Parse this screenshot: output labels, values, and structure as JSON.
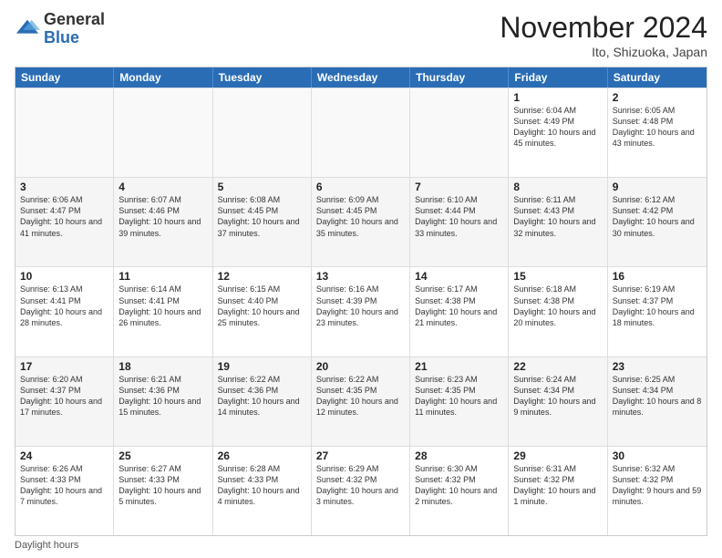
{
  "logo": {
    "general": "General",
    "blue": "Blue"
  },
  "title": "November 2024",
  "location": "Ito, Shizuoka, Japan",
  "weekdays": [
    "Sunday",
    "Monday",
    "Tuesday",
    "Wednesday",
    "Thursday",
    "Friday",
    "Saturday"
  ],
  "footer": "Daylight hours",
  "weeks": [
    [
      {
        "day": "",
        "info": ""
      },
      {
        "day": "",
        "info": ""
      },
      {
        "day": "",
        "info": ""
      },
      {
        "day": "",
        "info": ""
      },
      {
        "day": "",
        "info": ""
      },
      {
        "day": "1",
        "info": "Sunrise: 6:04 AM\nSunset: 4:49 PM\nDaylight: 10 hours and 45 minutes."
      },
      {
        "day": "2",
        "info": "Sunrise: 6:05 AM\nSunset: 4:48 PM\nDaylight: 10 hours and 43 minutes."
      }
    ],
    [
      {
        "day": "3",
        "info": "Sunrise: 6:06 AM\nSunset: 4:47 PM\nDaylight: 10 hours and 41 minutes."
      },
      {
        "day": "4",
        "info": "Sunrise: 6:07 AM\nSunset: 4:46 PM\nDaylight: 10 hours and 39 minutes."
      },
      {
        "day": "5",
        "info": "Sunrise: 6:08 AM\nSunset: 4:45 PM\nDaylight: 10 hours and 37 minutes."
      },
      {
        "day": "6",
        "info": "Sunrise: 6:09 AM\nSunset: 4:45 PM\nDaylight: 10 hours and 35 minutes."
      },
      {
        "day": "7",
        "info": "Sunrise: 6:10 AM\nSunset: 4:44 PM\nDaylight: 10 hours and 33 minutes."
      },
      {
        "day": "8",
        "info": "Sunrise: 6:11 AM\nSunset: 4:43 PM\nDaylight: 10 hours and 32 minutes."
      },
      {
        "day": "9",
        "info": "Sunrise: 6:12 AM\nSunset: 4:42 PM\nDaylight: 10 hours and 30 minutes."
      }
    ],
    [
      {
        "day": "10",
        "info": "Sunrise: 6:13 AM\nSunset: 4:41 PM\nDaylight: 10 hours and 28 minutes."
      },
      {
        "day": "11",
        "info": "Sunrise: 6:14 AM\nSunset: 4:41 PM\nDaylight: 10 hours and 26 minutes."
      },
      {
        "day": "12",
        "info": "Sunrise: 6:15 AM\nSunset: 4:40 PM\nDaylight: 10 hours and 25 minutes."
      },
      {
        "day": "13",
        "info": "Sunrise: 6:16 AM\nSunset: 4:39 PM\nDaylight: 10 hours and 23 minutes."
      },
      {
        "day": "14",
        "info": "Sunrise: 6:17 AM\nSunset: 4:38 PM\nDaylight: 10 hours and 21 minutes."
      },
      {
        "day": "15",
        "info": "Sunrise: 6:18 AM\nSunset: 4:38 PM\nDaylight: 10 hours and 20 minutes."
      },
      {
        "day": "16",
        "info": "Sunrise: 6:19 AM\nSunset: 4:37 PM\nDaylight: 10 hours and 18 minutes."
      }
    ],
    [
      {
        "day": "17",
        "info": "Sunrise: 6:20 AM\nSunset: 4:37 PM\nDaylight: 10 hours and 17 minutes."
      },
      {
        "day": "18",
        "info": "Sunrise: 6:21 AM\nSunset: 4:36 PM\nDaylight: 10 hours and 15 minutes."
      },
      {
        "day": "19",
        "info": "Sunrise: 6:22 AM\nSunset: 4:36 PM\nDaylight: 10 hours and 14 minutes."
      },
      {
        "day": "20",
        "info": "Sunrise: 6:22 AM\nSunset: 4:35 PM\nDaylight: 10 hours and 12 minutes."
      },
      {
        "day": "21",
        "info": "Sunrise: 6:23 AM\nSunset: 4:35 PM\nDaylight: 10 hours and 11 minutes."
      },
      {
        "day": "22",
        "info": "Sunrise: 6:24 AM\nSunset: 4:34 PM\nDaylight: 10 hours and 9 minutes."
      },
      {
        "day": "23",
        "info": "Sunrise: 6:25 AM\nSunset: 4:34 PM\nDaylight: 10 hours and 8 minutes."
      }
    ],
    [
      {
        "day": "24",
        "info": "Sunrise: 6:26 AM\nSunset: 4:33 PM\nDaylight: 10 hours and 7 minutes."
      },
      {
        "day": "25",
        "info": "Sunrise: 6:27 AM\nSunset: 4:33 PM\nDaylight: 10 hours and 5 minutes."
      },
      {
        "day": "26",
        "info": "Sunrise: 6:28 AM\nSunset: 4:33 PM\nDaylight: 10 hours and 4 minutes."
      },
      {
        "day": "27",
        "info": "Sunrise: 6:29 AM\nSunset: 4:32 PM\nDaylight: 10 hours and 3 minutes."
      },
      {
        "day": "28",
        "info": "Sunrise: 6:30 AM\nSunset: 4:32 PM\nDaylight: 10 hours and 2 minutes."
      },
      {
        "day": "29",
        "info": "Sunrise: 6:31 AM\nSunset: 4:32 PM\nDaylight: 10 hours and 1 minute."
      },
      {
        "day": "30",
        "info": "Sunrise: 6:32 AM\nSunset: 4:32 PM\nDaylight: 9 hours and 59 minutes."
      }
    ]
  ]
}
